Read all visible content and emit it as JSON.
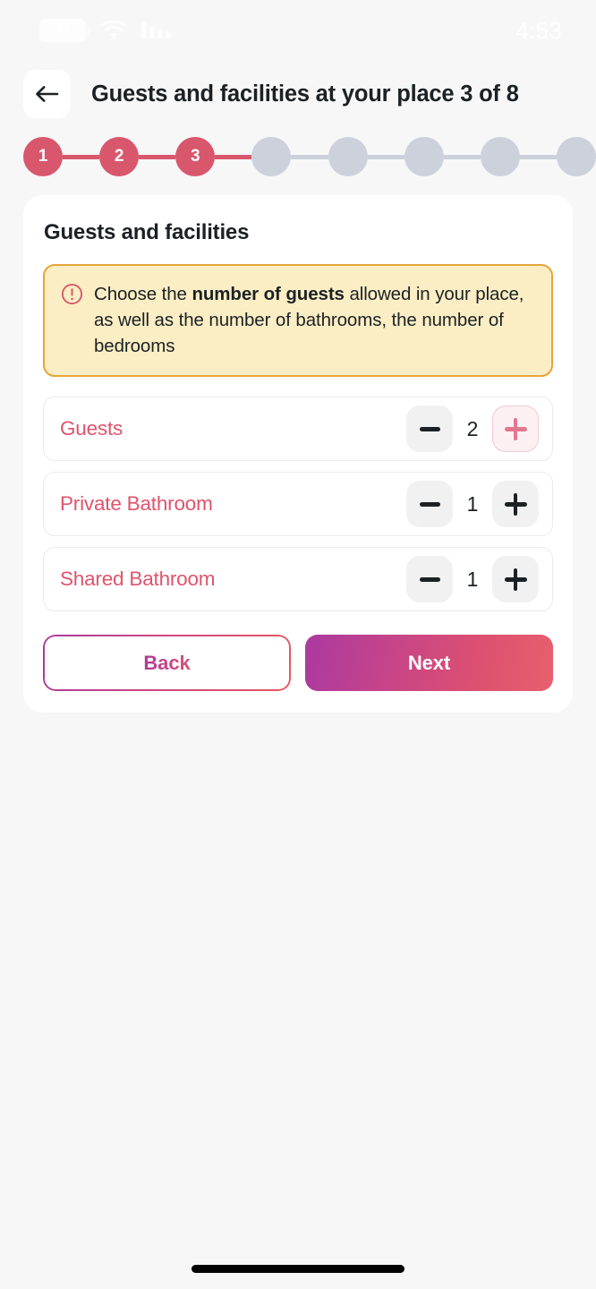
{
  "status_bar": {
    "battery_level": "47",
    "time": "4:53",
    "wifi_icon": "wifi-icon",
    "signal_icon": "signal-bars-icon"
  },
  "header": {
    "back_icon": "arrow-left-icon",
    "title": "Guests and facilities at your place 3 of 8"
  },
  "stepper": {
    "current_step": 3,
    "total_steps": 8,
    "active_color": "#d8576c",
    "inactive_color": "#ccd1dc",
    "steps": [
      {
        "label": "1",
        "state": "done"
      },
      {
        "label": "2",
        "state": "done"
      },
      {
        "label": "3",
        "state": "done"
      },
      {
        "label": "",
        "state": "todo"
      },
      {
        "label": "",
        "state": "todo"
      },
      {
        "label": "",
        "state": "todo"
      },
      {
        "label": "",
        "state": "todo"
      },
      {
        "label": "",
        "state": "todo"
      }
    ]
  },
  "card": {
    "title": "Guests and facilities",
    "alert": {
      "icon": "exclamation-circle-icon",
      "icon_color": "#d8576c",
      "border_color": "#e7a43c",
      "background_color": "#fbeec4",
      "text_before": "Choose the ",
      "text_bold": "number of guests",
      "text_after": " allowed in your place, as well as the number of bathrooms, the number of bedrooms"
    },
    "counters": [
      {
        "label": "Guests",
        "value": "2",
        "decrement_icon": "minus-icon",
        "increment_icon": "plus-icon",
        "increment_active": true
      },
      {
        "label": "Private Bathroom",
        "value": "1",
        "decrement_icon": "minus-icon",
        "increment_icon": "plus-icon",
        "increment_active": false
      },
      {
        "label": "Shared Bathroom",
        "value": "1",
        "decrement_icon": "minus-icon",
        "increment_icon": "plus-icon",
        "increment_active": false
      }
    ],
    "actions": {
      "back_label": "Back",
      "next_label": "Next"
    }
  },
  "colors": {
    "accent_pink": "#e0536c",
    "gradient_start": "#ab39a0",
    "gradient_end": "#e8606d",
    "page_background": "#f7f7f7"
  }
}
